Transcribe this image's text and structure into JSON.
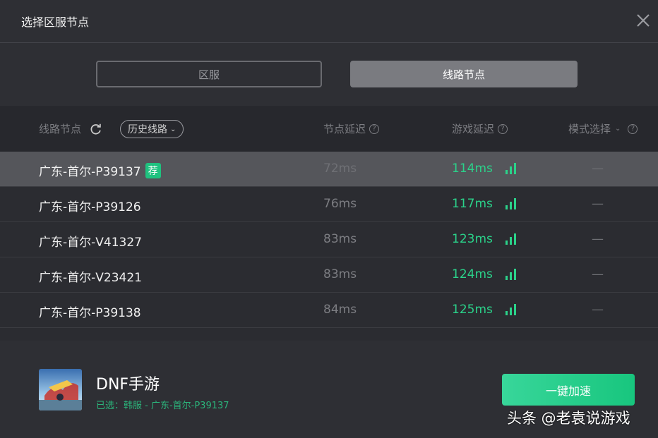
{
  "title": "选择区服节点",
  "tabs": {
    "region": "区服",
    "route": "线路节点"
  },
  "header": {
    "route_node": "线路节点",
    "history": "历史线路",
    "node_latency": "节点延迟",
    "game_latency": "游戏延迟",
    "mode_select": "模式选择"
  },
  "rows": [
    {
      "name": "广东-首尔-P39137",
      "badge": "荐",
      "node": "72ms",
      "game": "114ms",
      "mode": "—"
    },
    {
      "name": "广东-首尔-P39126",
      "node": "76ms",
      "game": "117ms",
      "mode": "—"
    },
    {
      "name": "广东-首尔-V41327",
      "node": "83ms",
      "game": "123ms",
      "mode": "—"
    },
    {
      "name": "广东-首尔-V23421",
      "node": "83ms",
      "game": "124ms",
      "mode": "—"
    },
    {
      "name": "广东-首尔-P39138",
      "node": "84ms",
      "game": "125ms",
      "mode": "—"
    }
  ],
  "footer": {
    "game_name": "DNF手游",
    "selected": "已选：韩服 - 广东-首尔-P39137",
    "accelerate": "一键加速",
    "watermark": "头条 @老袁说游戏"
  },
  "colors": {
    "accent": "#1fc27f",
    "latency_good": "#2bd28a",
    "selected_row": "#55565b"
  },
  "icons": {
    "close": "close-icon",
    "refresh": "refresh-icon",
    "help": "question-icon",
    "signal": "signal-bars-icon",
    "game": "game-cover-icon"
  }
}
